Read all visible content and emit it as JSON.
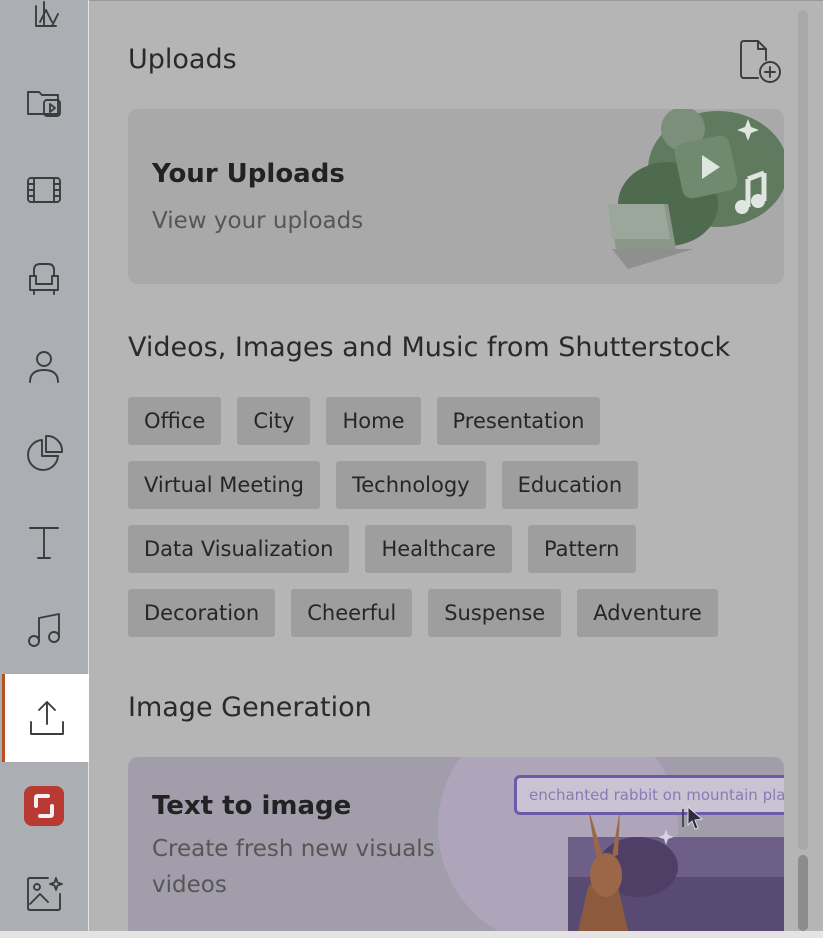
{
  "rail": {
    "items": [
      {
        "icon": "design-tools-icon"
      },
      {
        "icon": "media-folder-icon"
      },
      {
        "icon": "film-icon"
      },
      {
        "icon": "armchair-icon"
      },
      {
        "icon": "person-icon"
      },
      {
        "icon": "pie-chart-icon"
      },
      {
        "icon": "text-icon"
      },
      {
        "icon": "music-note-icon"
      },
      {
        "icon": "upload-icon",
        "active": true
      },
      {
        "icon": "shutterstock-logo-icon"
      },
      {
        "icon": "image-sparkle-icon"
      }
    ],
    "active_accent": "#b5521f"
  },
  "uploads": {
    "title": "Uploads",
    "add_icon": "add-file-icon",
    "card": {
      "title": "Your Uploads",
      "subtitle": "View your uploads"
    }
  },
  "shutterstock": {
    "title": "Videos, Images and Music from Shutterstock",
    "rows": [
      [
        "Office",
        "City",
        "Home",
        "Presentation"
      ],
      [
        "Virtual Meeting",
        "Technology",
        "Education"
      ],
      [
        "Data Visualization",
        "Healthcare",
        "Pattern"
      ],
      [
        "Decoration",
        "Cheerful",
        "Suspense",
        "Adventure"
      ]
    ]
  },
  "image_generation": {
    "title": "Image Generation",
    "card": {
      "title": "Text to image",
      "subtitle_line1": "Create fresh new visuals for your",
      "subtitle_line2": "videos",
      "prompt_example": "enchanted rabbit on mountain pla"
    }
  }
}
